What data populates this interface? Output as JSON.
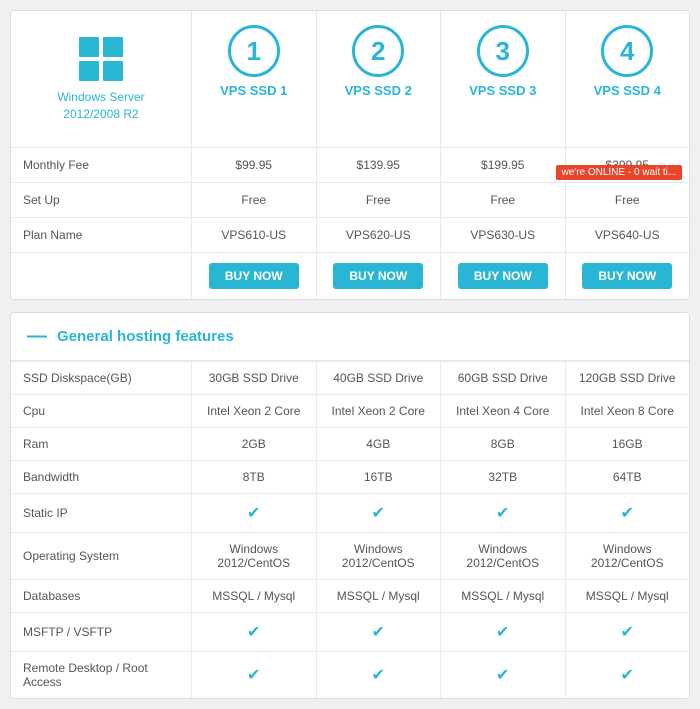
{
  "logo": {
    "title_line1": "Windows Server",
    "title_line2": "2012/2008 R2"
  },
  "plans": [
    {
      "number": "1",
      "name": "VPS SSD 1"
    },
    {
      "number": "2",
      "name": "VPS SSD 2"
    },
    {
      "number": "3",
      "name": "VPS SSD 3"
    },
    {
      "number": "4",
      "name": "VPS SSD 4"
    }
  ],
  "rows": [
    {
      "label": "Monthly Fee",
      "values": [
        "$99.95",
        "$139.95",
        "$199.95",
        "$399.95"
      ]
    },
    {
      "label": "Set Up",
      "values": [
        "Free",
        "Free",
        "Free",
        "Free"
      ]
    },
    {
      "label": "Plan Name",
      "values": [
        "VPS610-US",
        "VPS620-US",
        "VPS630-US",
        "VPS640-US"
      ]
    }
  ],
  "buy_label": "Buy Now",
  "online_badge": "we're ONLINE - 0 wait ti...",
  "general_section": {
    "title": "General hosting features",
    "features": [
      {
        "label": "SSD Diskspace(GB)",
        "values": [
          "30GB SSD Drive",
          "40GB SSD Drive",
          "60GB SSD Drive",
          "120GB SSD Drive"
        ]
      },
      {
        "label": "Cpu",
        "values": [
          "Intel Xeon 2 Core",
          "Intel Xeon 2 Core",
          "Intel Xeon 4 Core",
          "Intel Xeon 8 Core"
        ]
      },
      {
        "label": "Ram",
        "values": [
          "2GB",
          "4GB",
          "8GB",
          "16GB"
        ]
      },
      {
        "label": "Bandwidth",
        "values": [
          "8TB",
          "16TB",
          "32TB",
          "64TB"
        ]
      },
      {
        "label": "Static IP",
        "values": [
          "check",
          "check",
          "check",
          "check"
        ]
      },
      {
        "label": "Operating System",
        "values": [
          "Windows 2012/CentOS",
          "Windows 2012/CentOS",
          "Windows 2012/CentOS",
          "Windows 2012/CentOS"
        ]
      },
      {
        "label": "Databases",
        "values": [
          "MSSQL / Mysql",
          "MSSQL / Mysql",
          "MSSQL / Mysql",
          "MSSQL / Mysql"
        ]
      },
      {
        "label": "MSFTP / VSFTP",
        "values": [
          "check",
          "check",
          "check",
          "check"
        ]
      },
      {
        "label": "Remote Desktop / Root Access",
        "values": [
          "check",
          "check",
          "check",
          "check"
        ]
      }
    ]
  }
}
